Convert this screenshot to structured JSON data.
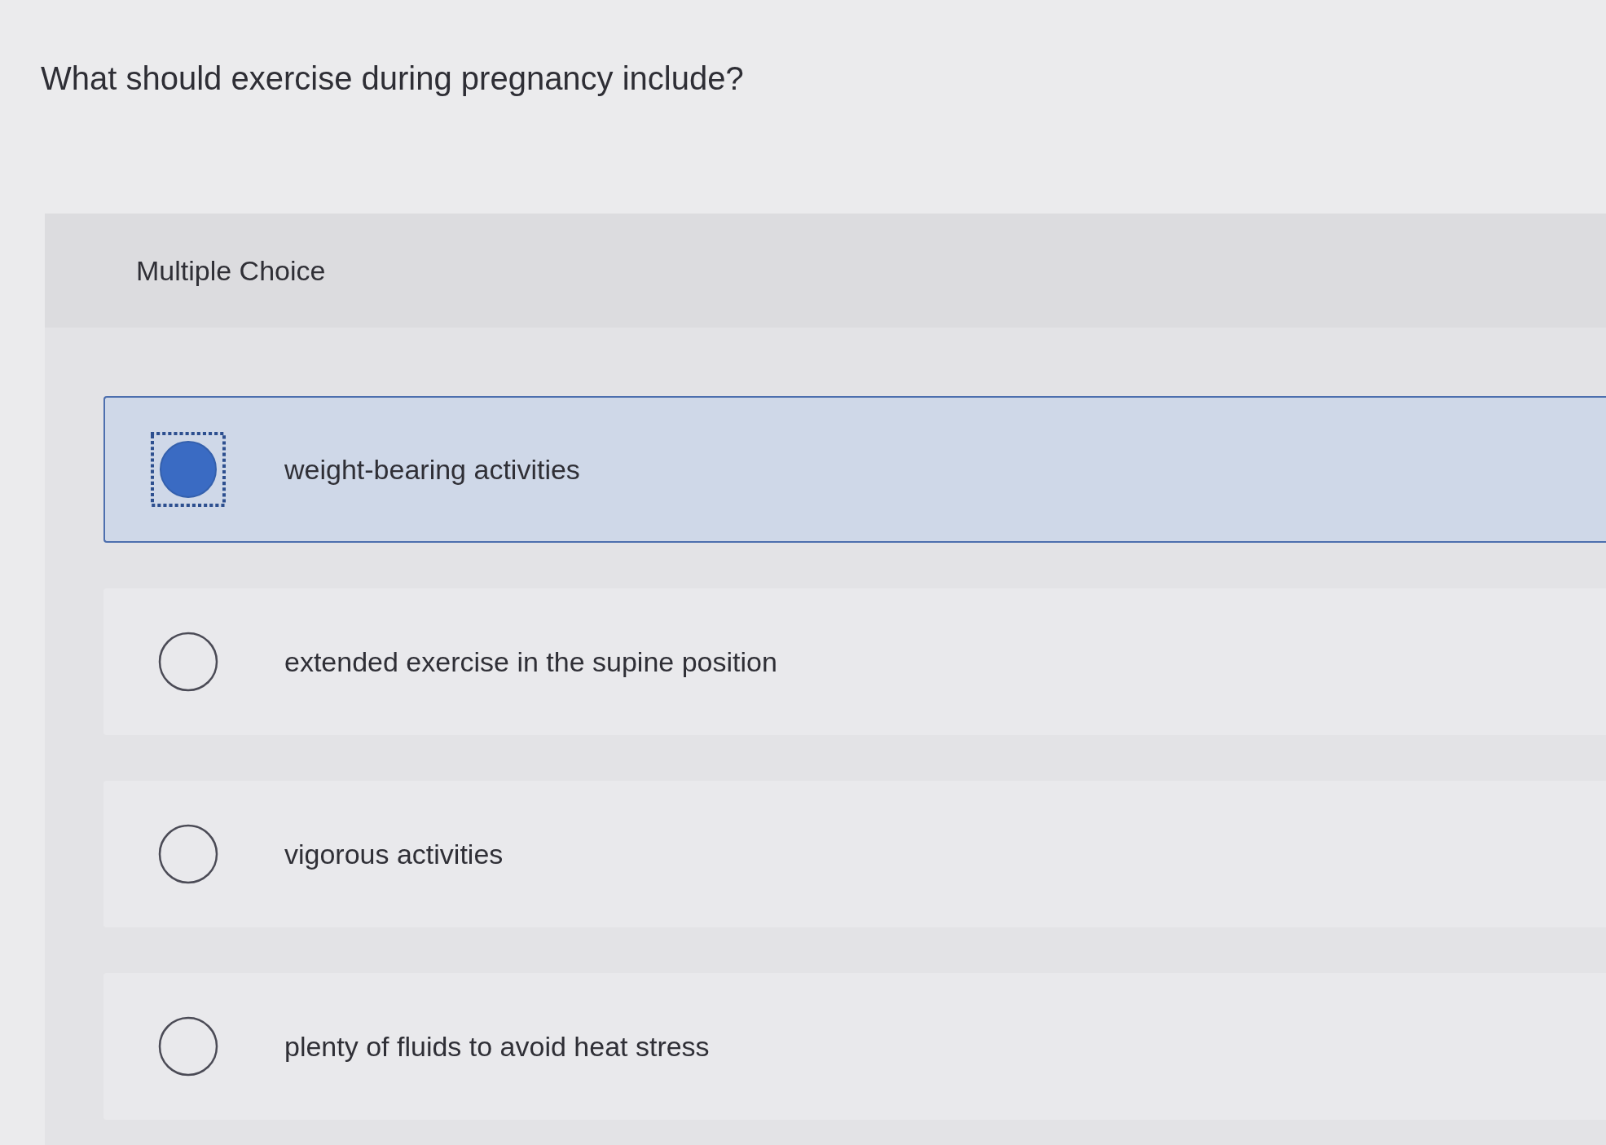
{
  "question": "What should exercise during pregnancy include?",
  "panel": {
    "header": "Multiple Choice",
    "options": [
      {
        "label": "weight-bearing activities",
        "selected": true,
        "focused": true
      },
      {
        "label": "extended exercise in the supine position",
        "selected": false,
        "focused": false
      },
      {
        "label": "vigorous activities",
        "selected": false,
        "focused": false
      },
      {
        "label": "plenty of fluids to avoid heat stress",
        "selected": false,
        "focused": false
      }
    ]
  }
}
